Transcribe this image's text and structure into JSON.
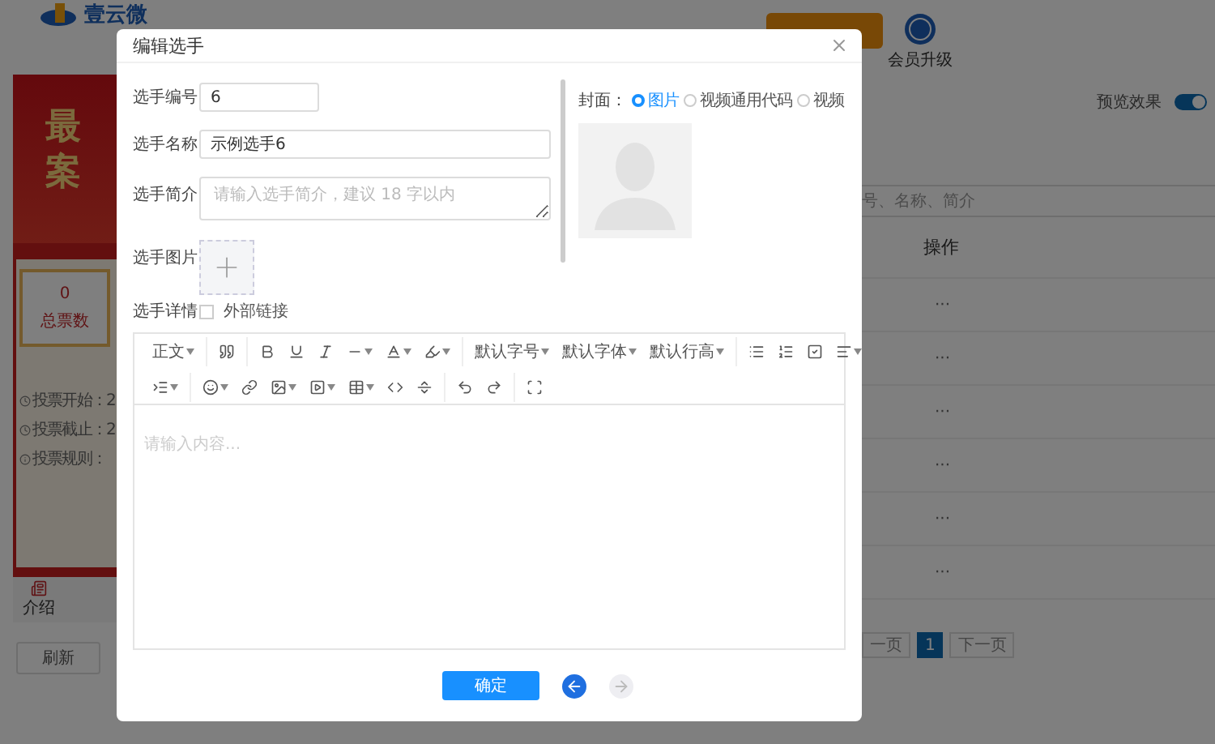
{
  "header": {
    "logo_text": "壹云微",
    "member_upgrade": "会员升级"
  },
  "preview_panel": {
    "banner_chars": [
      "最",
      "案"
    ],
    "total_votes": "0",
    "total_votes_label": "总票数",
    "info": [
      "投票开始：2",
      "投票截止：2",
      "投票规则："
    ],
    "tab": "介绍",
    "refresh": "刷新"
  },
  "side": {
    "preview_toggle": {
      "label": "预览效果",
      "on": true
    },
    "search": {
      "placeholder": "号、名称、简介"
    },
    "table": {
      "action_header": "操作",
      "rows": [
        "···",
        "···",
        "···",
        "···",
        "···",
        "···"
      ]
    },
    "pagination": {
      "prev": "一页",
      "pages": [
        {
          "label": "1",
          "selected": true
        }
      ],
      "next": "下一页"
    }
  },
  "dialog": {
    "title": "编辑选手",
    "fields": [
      {
        "kind": "input",
        "label": "选手编号",
        "value": "6"
      },
      {
        "kind": "input",
        "label": "选手名称",
        "value": "示例选手6"
      },
      {
        "kind": "textarea",
        "label": "选手简介",
        "placeholder": "请输入选手简介，建议 18 字以内"
      },
      {
        "kind": "upload",
        "label": "选手图片"
      },
      {
        "kind": "checkbox",
        "label": "选手详情",
        "option": "外部链接",
        "checked": false
      }
    ],
    "cover": {
      "label": "封面：",
      "options": [
        {
          "label": "图片",
          "selected": true
        },
        {
          "label": "视频通用代码",
          "selected": false
        },
        {
          "label": "视频",
          "selected": false
        }
      ]
    },
    "editor": {
      "toolbar_labels": [
        "正文",
        "默认字号",
        "默认字体",
        "默认行高"
      ],
      "placeholder": "请输入内容..."
    },
    "confirm": "确定",
    "nav_arrows": [
      {
        "kind": "back",
        "disabled": false
      },
      {
        "kind": "forward",
        "disabled": true
      }
    ]
  }
}
